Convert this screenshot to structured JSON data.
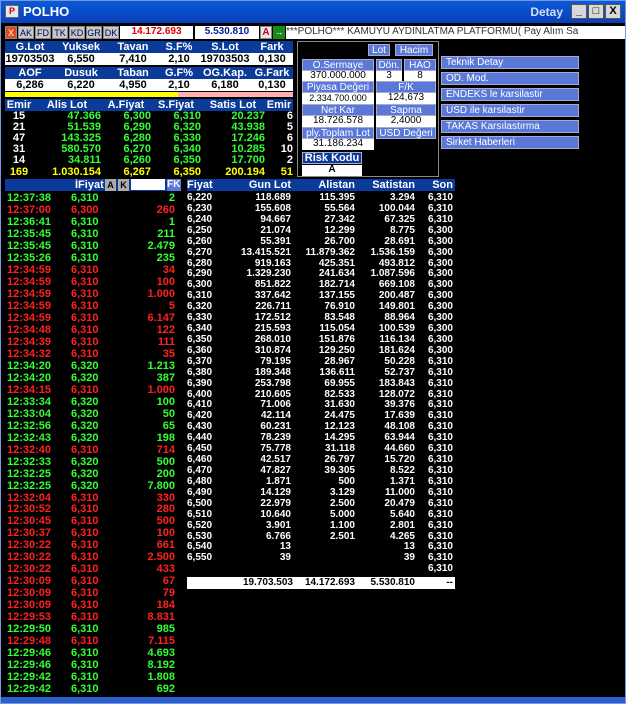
{
  "window": {
    "title": "POLHO",
    "right_title": "Detay",
    "logo": "P",
    "min": "_",
    "max": "□",
    "close": "X"
  },
  "toolbar": {
    "close_label": "X",
    "tabs": [
      "AK",
      "FD",
      "TK",
      "KD",
      "GR",
      "DK"
    ],
    "value1": "14.172.693",
    "value2": "5.530.810",
    "a_label": "A",
    "arrow": "→",
    "ticker": "***POLHO*** KAMUYU AYDINLATMA PLATFORMU( Pay Alım Sa"
  },
  "summary": {
    "headers1": [
      "G.Lot",
      "Yuksek",
      "Tavan",
      "S.F%",
      "S.Lot",
      "Fark"
    ],
    "values1": [
      "19703503",
      "6,550",
      "7,410",
      "2,10",
      "19703503",
      "0,130"
    ],
    "headers2": [
      "AOF",
      "Dusuk",
      "Taban",
      "G.F%",
      "OG.Kap.",
      "G.Fark"
    ],
    "values2": [
      "6,286",
      "6,220",
      "4,950",
      "2,10",
      "6,180",
      "0,130"
    ],
    "orders_headers": [
      "Emir",
      "Alis Lot",
      "A.Fiyat",
      "S.Fiyat",
      "Satis Lot",
      "Emir"
    ],
    "orders": [
      [
        "15",
        "47.366",
        "6,300",
        "6,310",
        "20.237",
        "6"
      ],
      [
        "21",
        "51.539",
        "6,290",
        "6,320",
        "43.938",
        "5"
      ],
      [
        "47",
        "143.325",
        "6,280",
        "6,330",
        "17.246",
        "6"
      ],
      [
        "31",
        "580.570",
        "6,270",
        "6,340",
        "10.285",
        "10"
      ],
      [
        "14",
        "34.811",
        "6,260",
        "6,350",
        "17.700",
        "2"
      ]
    ],
    "total": [
      "169",
      "1.030.154",
      "6,267",
      "6,350",
      "200.194",
      "51"
    ]
  },
  "side": {
    "lot_btn": "Lot",
    "hacim_btn": "Hacim",
    "o_sermaye_label": "O.Sermaye",
    "o_sermaye": "370.000.000",
    "don_label": "Dön.",
    "don": "3",
    "hao_label": "HAO",
    "hao": "8",
    "piyasa_label": "Piyasa Değeri",
    "piyasa": "2.334.700.000",
    "fk_label": "F/K",
    "fk": "124,673",
    "netkar_label": "Net Kar",
    "netkar": "18.726.578",
    "sapma_label": "Sapma",
    "sapma": "2,4000",
    "ply_label": "ply.Toplam Lot",
    "ply": "31.186.234",
    "usd_label": "USD Değeri",
    "risk_label": "Risk Kodu",
    "risk": "A"
  },
  "menu": [
    "Teknik Detay",
    "OD. Mod.",
    "ENDEKS le karsilastir",
    "USD ile karsilastir",
    "TAKAS Karsılastırma",
    "Sirket Haberleri"
  ],
  "trades_header": {
    "fiyat": "İFiyat",
    "a": "A",
    "k": "K",
    "fk": "FK"
  },
  "trades": [
    [
      "12:37:38",
      "6,310",
      "2",
      "g"
    ],
    [
      "12:37:00",
      "6,300",
      "260",
      "r"
    ],
    [
      "12:36:41",
      "6,310",
      "1",
      "g"
    ],
    [
      "12:35:45",
      "6,310",
      "211",
      "g"
    ],
    [
      "12:35:45",
      "6,310",
      "2.479",
      "g"
    ],
    [
      "12:35:26",
      "6,310",
      "235",
      "g"
    ],
    [
      "12:34:59",
      "6,310",
      "34",
      "r"
    ],
    [
      "12:34:59",
      "6,310",
      "100",
      "r"
    ],
    [
      "12:34:59",
      "6,310",
      "1.000",
      "r"
    ],
    [
      "12:34:59",
      "6,310",
      "5",
      "r"
    ],
    [
      "12:34:59",
      "6,310",
      "6.147",
      "r"
    ],
    [
      "12:34:48",
      "6,310",
      "122",
      "r"
    ],
    [
      "12:34:39",
      "6,310",
      "111",
      "r"
    ],
    [
      "12:34:32",
      "6,310",
      "35",
      "r"
    ],
    [
      "12:34:20",
      "6,320",
      "1.213",
      "g"
    ],
    [
      "12:34:20",
      "6,320",
      "387",
      "g"
    ],
    [
      "12:34:15",
      "6,310",
      "1.000",
      "r"
    ],
    [
      "12:33:34",
      "6,320",
      "100",
      "g"
    ],
    [
      "12:33:04",
      "6,320",
      "50",
      "g"
    ],
    [
      "12:32:56",
      "6,320",
      "65",
      "g"
    ],
    [
      "12:32:43",
      "6,320",
      "198",
      "g"
    ],
    [
      "12:32:40",
      "6,310",
      "714",
      "r"
    ],
    [
      "12:32:33",
      "6,320",
      "500",
      "g"
    ],
    [
      "12:32:25",
      "6,320",
      "200",
      "g"
    ],
    [
      "12:32:25",
      "6,320",
      "7.800",
      "g"
    ],
    [
      "12:32:04",
      "6,310",
      "330",
      "r"
    ],
    [
      "12:30:52",
      "6,310",
      "280",
      "r"
    ],
    [
      "12:30:45",
      "6,310",
      "500",
      "r"
    ],
    [
      "12:30:37",
      "6,310",
      "100",
      "r"
    ],
    [
      "12:30:22",
      "6,310",
      "661",
      "r"
    ],
    [
      "12:30:22",
      "6,310",
      "2.500",
      "r"
    ],
    [
      "12:30:22",
      "6,310",
      "433",
      "r"
    ],
    [
      "12:30:09",
      "6,310",
      "67",
      "r"
    ],
    [
      "12:30:09",
      "6,310",
      "79",
      "r"
    ],
    [
      "12:30:09",
      "6,310",
      "184",
      "r"
    ],
    [
      "12:29:53",
      "6,310",
      "8.831",
      "r"
    ],
    [
      "12:29:50",
      "6,310",
      "985",
      "g"
    ],
    [
      "12:29:48",
      "6,310",
      "7.115",
      "r"
    ],
    [
      "12:29:46",
      "6,310",
      "4.693",
      "g"
    ],
    [
      "12:29:46",
      "6,310",
      "8.192",
      "g"
    ],
    [
      "12:29:42",
      "6,310",
      "1.808",
      "g"
    ],
    [
      "12:29:42",
      "6,310",
      "692",
      "g"
    ]
  ],
  "depth_header": [
    "Fiyat",
    "Gun Lot",
    "Alistan",
    "Satistan",
    "Son"
  ],
  "depth": [
    [
      "6,220",
      "118.689",
      "115.395",
      "3.294",
      "6,310"
    ],
    [
      "6,230",
      "155.608",
      "55.564",
      "100.044",
      "6,310"
    ],
    [
      "6,240",
      "94.667",
      "27.342",
      "67.325",
      "6,310"
    ],
    [
      "6,250",
      "21.074",
      "12.299",
      "8.775",
      "6,300"
    ],
    [
      "6,260",
      "55.391",
      "26.700",
      "28.691",
      "6,300"
    ],
    [
      "6,270",
      "13.415.521",
      "11.879.362",
      "1.536.159",
      "6,300"
    ],
    [
      "6,280",
      "919.163",
      "425.351",
      "493.812",
      "6,300"
    ],
    [
      "6,290",
      "1.329.230",
      "241.634",
      "1.087.596",
      "6,300"
    ],
    [
      "6,300",
      "851.822",
      "182.714",
      "669.108",
      "6,300"
    ],
    [
      "6,310",
      "337.642",
      "137.155",
      "200.487",
      "6,300"
    ],
    [
      "6,320",
      "226.711",
      "76.910",
      "149.801",
      "6,300"
    ],
    [
      "6,330",
      "172.512",
      "83.548",
      "88.964",
      "6,300"
    ],
    [
      "6,340",
      "215.593",
      "115.054",
      "100.539",
      "6,300"
    ],
    [
      "6,350",
      "268.010",
      "151.876",
      "116.134",
      "6,300"
    ],
    [
      "6,360",
      "310.874",
      "129.250",
      "181.624",
      "6,300"
    ],
    [
      "6,370",
      "79.195",
      "28.967",
      "50.228",
      "6,310"
    ],
    [
      "6,380",
      "189.348",
      "136.611",
      "52.737",
      "6,310"
    ],
    [
      "6,390",
      "253.798",
      "69.955",
      "183.843",
      "6,310"
    ],
    [
      "6,400",
      "210.605",
      "82.533",
      "128.072",
      "6,310"
    ],
    [
      "6,410",
      "71.006",
      "31.630",
      "39.376",
      "6,310"
    ],
    [
      "6,420",
      "42.114",
      "24.475",
      "17.639",
      "6,310"
    ],
    [
      "6,430",
      "60.231",
      "12.123",
      "48.108",
      "6,310"
    ],
    [
      "6,440",
      "78.239",
      "14.295",
      "63.944",
      "6,310"
    ],
    [
      "6,450",
      "75.778",
      "31.118",
      "44.660",
      "6,310"
    ],
    [
      "6,460",
      "42.517",
      "26.797",
      "15.720",
      "6,310"
    ],
    [
      "6,470",
      "47.827",
      "39.305",
      "8.522",
      "6,310"
    ],
    [
      "6,480",
      "1.871",
      "500",
      "1.371",
      "6,310"
    ],
    [
      "6,490",
      "14.129",
      "3.129",
      "11.000",
      "6,310"
    ],
    [
      "6,500",
      "22.979",
      "2.500",
      "20.479",
      "6,310"
    ],
    [
      "6,510",
      "10.640",
      "5.000",
      "5.640",
      "6,310"
    ],
    [
      "6,520",
      "3.901",
      "1.100",
      "2.801",
      "6,310"
    ],
    [
      "6,530",
      "6.766",
      "2.501",
      "4.265",
      "6,310"
    ],
    [
      "6,540",
      "13",
      "",
      "13",
      "6,310"
    ],
    [
      "6,550",
      "39",
      "",
      "39",
      "6,310"
    ],
    [
      "",
      "",
      "",
      "",
      "6,310"
    ]
  ],
  "depth_total": [
    "19.703.503",
    "14.172.693",
    "5.530.810",
    "--"
  ],
  "colors": {
    "green": "#33ff33",
    "red": "#ff2020",
    "header_blue": "#0a3a9a",
    "menu_blue": "#5a78d8"
  }
}
